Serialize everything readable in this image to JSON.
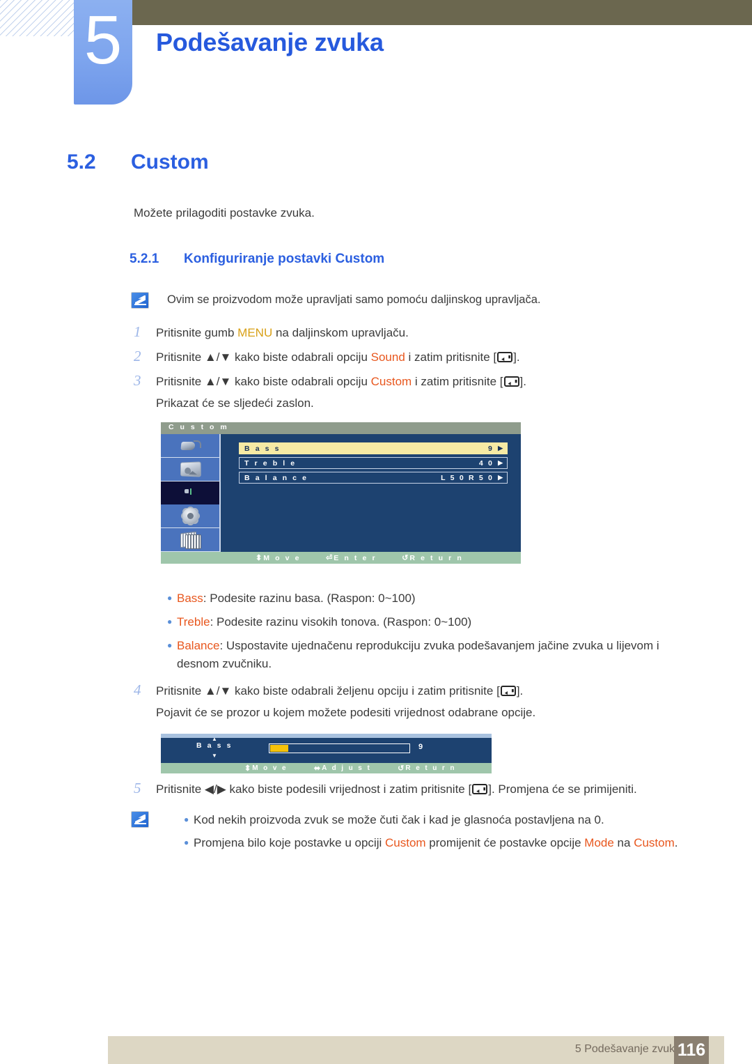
{
  "header": {
    "chapter_number": "5",
    "chapter_title": "Podešavanje zvuka"
  },
  "section": {
    "number": "5.2",
    "title": "Custom",
    "intro": "Možete prilagoditi postavke zvuka.",
    "subsection_number": "5.2.1",
    "subsection_title": "Konfiguriranje postavki Custom"
  },
  "top_note": {
    "text": "Ovim se proizvodom može upravljati samo pomoću daljinskog upravljača.",
    "icon": "note-pencil-icon"
  },
  "steps": [
    {
      "number": "1",
      "prefix": "Pritisnite gumb ",
      "keyword": "MENU",
      "keyword_color": "gold",
      "suffix": " na daljinskom upravljaču.",
      "has_enter_key": false
    },
    {
      "number": "2",
      "prefix": "Pritisnite ▲/▼ kako biste odabrali opciju ",
      "keyword": "Sound",
      "keyword_color": "orange",
      "suffix": " i zatim pritisnite [",
      "tail": "].",
      "has_enter_key": true
    },
    {
      "number": "3",
      "prefix": "Pritisnite ▲/▼ kako biste odabrali opciju ",
      "keyword": "Custom",
      "keyword_color": "orange",
      "suffix": " i zatim pritisnite [",
      "tail": "].",
      "has_enter_key": true
    }
  ],
  "step3_followup": "Prikazat će se sljedeći zaslon.",
  "osd_main": {
    "title": "C u s t o m",
    "sidebar_icons": [
      {
        "name": "input-source-icon",
        "selected": false
      },
      {
        "name": "picture-icon",
        "selected": false
      },
      {
        "name": "sound-icon",
        "selected": true
      },
      {
        "name": "setup-gear-icon",
        "selected": false
      },
      {
        "name": "multi-control-icon",
        "selected": false
      }
    ],
    "rows": [
      {
        "label": "B a s s",
        "value": "9",
        "highlighted": true
      },
      {
        "label": "T r e b l e",
        "value": "4 0",
        "highlighted": false
      },
      {
        "label": "B a l a n c e",
        "value": "L 5 0   R 5 0",
        "highlighted": false
      }
    ],
    "arrow_glyph": "▶",
    "bottom_bar": [
      {
        "glyph": "⬍",
        "label": "M o v e"
      },
      {
        "glyph": "⏎",
        "label": "E n t e r"
      },
      {
        "glyph": "↺",
        "label": "R e t u r n"
      }
    ]
  },
  "options": [
    {
      "keyword": "Bass",
      "text": ": Podesite razinu basa. (Raspon: 0~100)"
    },
    {
      "keyword": "Treble",
      "text": ": Podesite razinu visokih tonova. (Raspon: 0~100)"
    },
    {
      "keyword": "Balance",
      "text": ": Uspostavite ujednačenu reprodukciju zvuka podešavanjem jačine zvuka u lijevom i desnom zvučniku."
    }
  ],
  "step4": {
    "number": "4",
    "prefix": "Pritisnite ▲/▼ kako biste odabrali željenu opciju i zatim pritisnite [",
    "tail": "].",
    "followup": "Pojavit će se prozor u kojem možete podesiti vrijednost odabrane opcije."
  },
  "osd_adjust": {
    "label": "B a s s",
    "value": "9",
    "fill_percent": 13,
    "up_glyph": "▲",
    "down_glyph": "▼",
    "bottom_bar": [
      {
        "glyph": "⬍",
        "label": "M o v e"
      },
      {
        "glyph": "⬌",
        "label": "A d j u s t"
      },
      {
        "glyph": "↺",
        "label": "R e t u r n"
      }
    ]
  },
  "step5": {
    "number": "5",
    "prefix": "Pritisnite ◀/▶ kako biste podesili vrijednost i zatim pritisnite [",
    "tail": "]. Promjena će se primijeniti."
  },
  "bottom_notes": {
    "icon": "note-pencil-icon",
    "items": [
      {
        "full": "Kod nekih proizvoda zvuk se može čuti čak i kad je glasnoća postavljena na 0."
      },
      {
        "p1": "Promjena bilo koje postavke u opciji ",
        "k1": "Custom",
        "p2": " promijenit će postavke opcije ",
        "k2": "Mode",
        "p3": " na ",
        "k3": "Custom",
        "p4": "."
      }
    ]
  },
  "footer": {
    "text": "5 Podešavanje zvuka",
    "page": "116"
  },
  "colors": {
    "heading_blue": "#2b5fe0",
    "keyword_orange": "#e8571e",
    "keyword_gold": "#d8a017",
    "olive": "#6b674f",
    "tab_blue": "#7ea5ee",
    "osd_navy": "#1d4270",
    "osd_highlight": "#f6eaa4",
    "osd_green": "#9fc6ab",
    "footer_beige": "#ddd7c4",
    "footer_brown": "#8a7f70"
  }
}
